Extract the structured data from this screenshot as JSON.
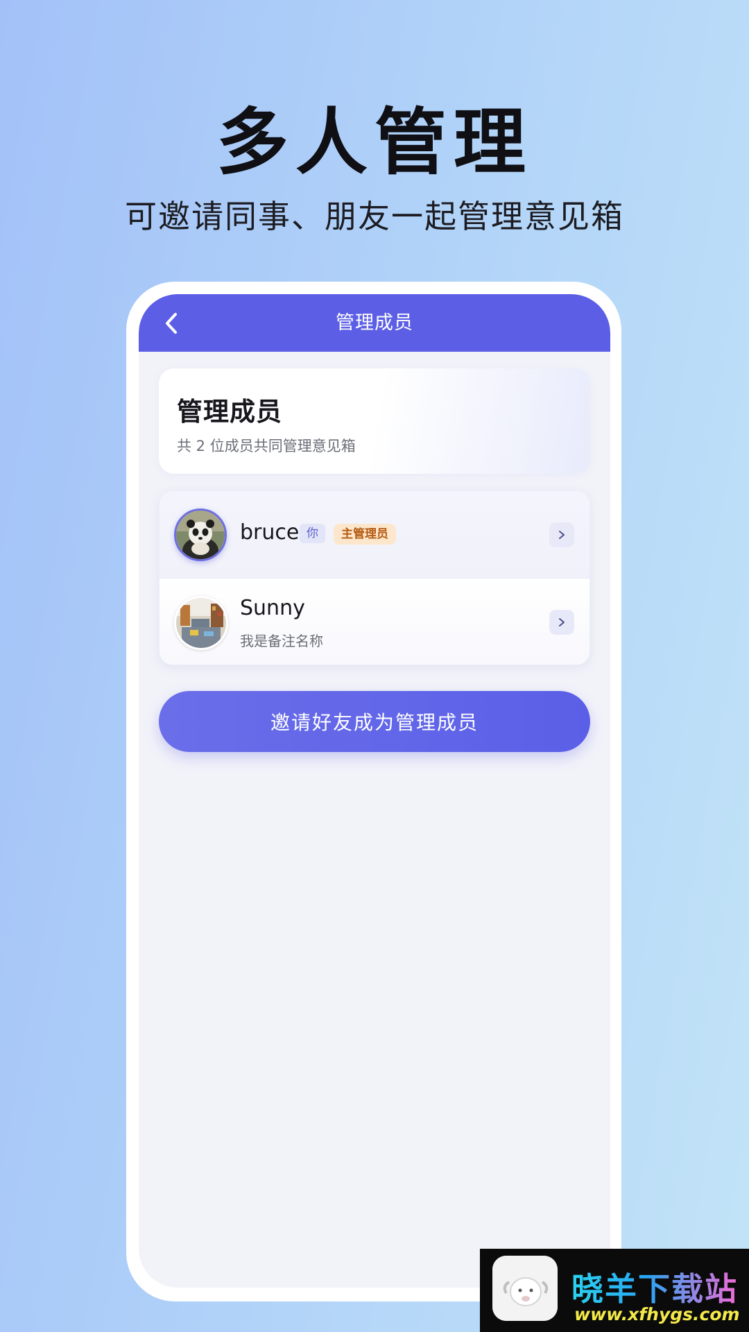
{
  "hero": {
    "title": "多人管理",
    "subtitle": "可邀请同事、朋友一起管理意见箱"
  },
  "nav": {
    "back_icon": "chevron-left-icon",
    "title": "管理成员"
  },
  "summary": {
    "title": "管理成员",
    "subtitle": "共 2 位成员共同管理意见箱"
  },
  "members": [
    {
      "name": "bruce",
      "badge_you": "你",
      "badge_role": "主管理员",
      "avatar": "panda-avatar"
    },
    {
      "name": "Sunny",
      "note": "我是备注名称",
      "avatar": "room-avatar"
    }
  ],
  "invite": {
    "label": "邀请好友成为管理成员"
  },
  "watermark": {
    "text": "晓羊下载站",
    "url": "www.xfhygs.com"
  },
  "colors": {
    "accent": "#5c5fe6",
    "admin_badge_bg": "#fde7cc",
    "admin_badge_text": "#b55b12",
    "you_badge_bg": "#e2e4f7"
  }
}
